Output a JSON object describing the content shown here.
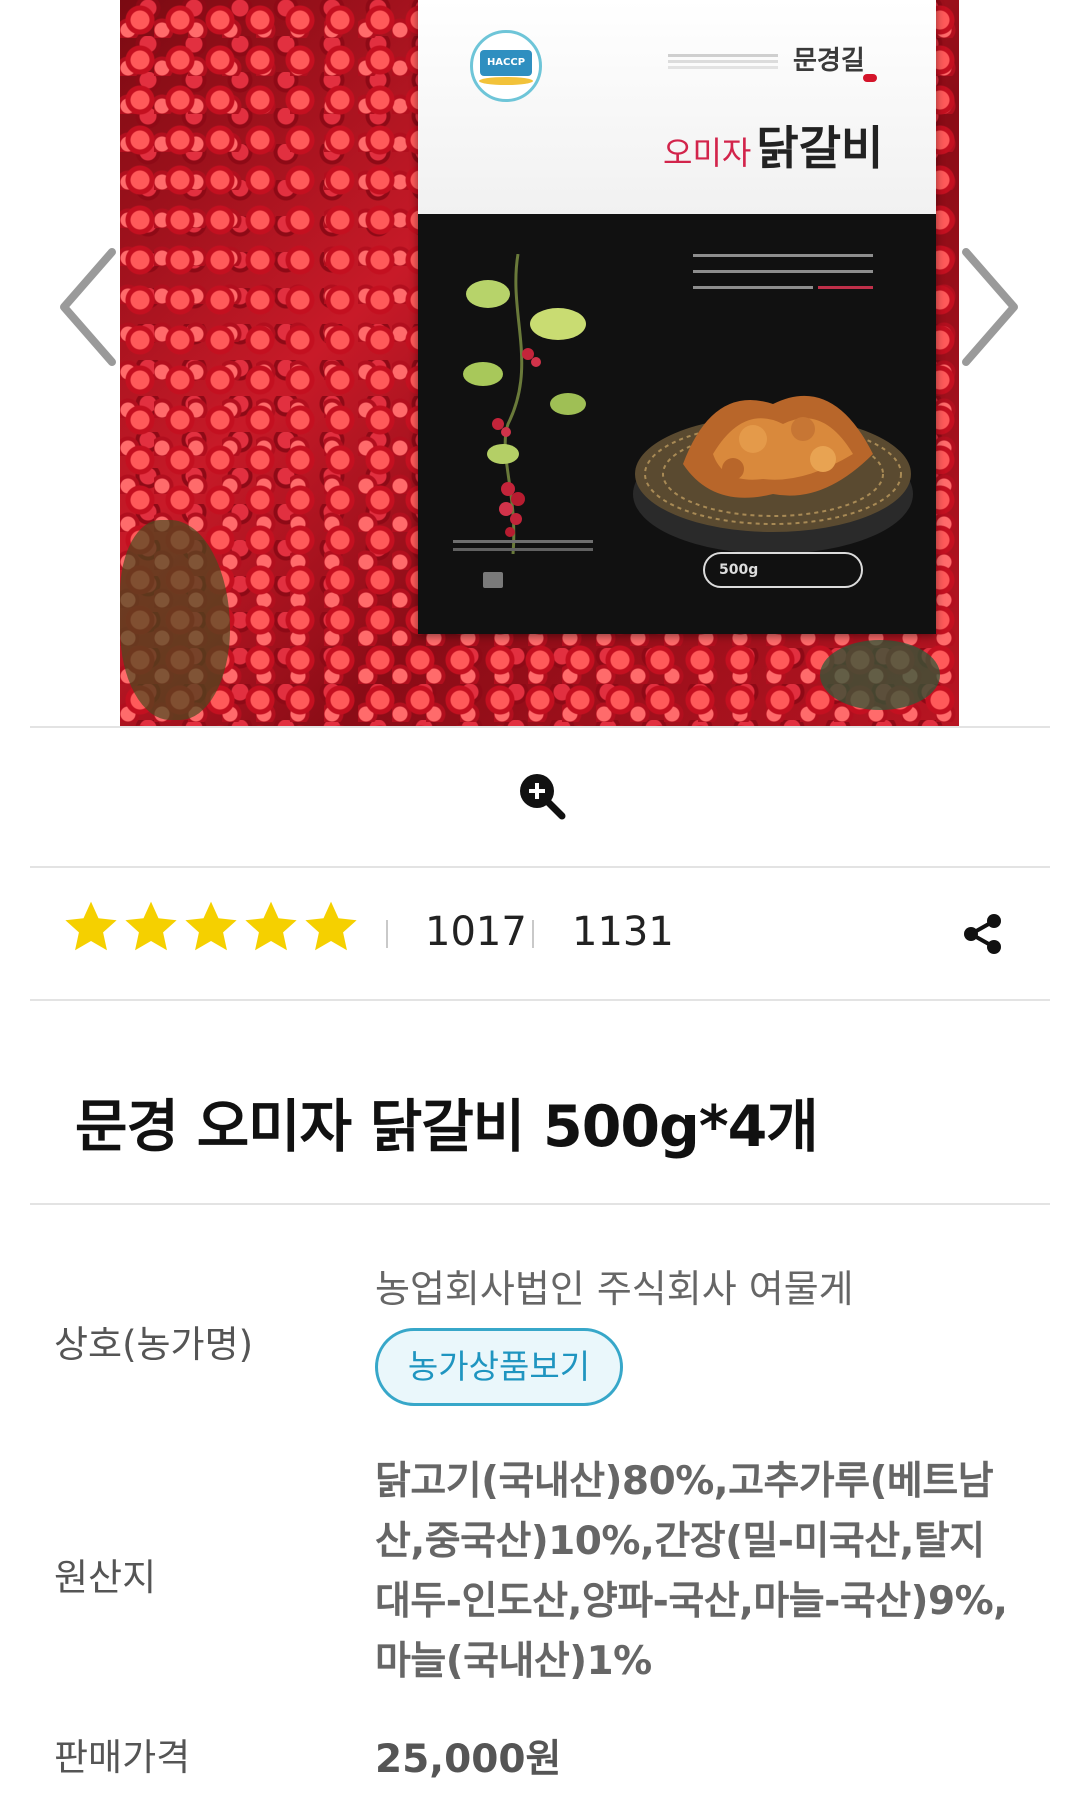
{
  "product_image": {
    "package_brand": "문경길",
    "package_title_small": "오미자",
    "package_title_large": "닭갈비",
    "certification": "HACCP",
    "package_weight": "500g",
    "prev_icon": "chevron-left-icon",
    "next_icon": "chevron-right-icon"
  },
  "zoom": {
    "icon": "zoom-in-icon"
  },
  "rating": {
    "stars": 5,
    "star_color": "#f5d000",
    "count_a": "1017",
    "count_b": "1131",
    "share_icon": "share-icon"
  },
  "product": {
    "title": "문경 오미자 닭갈비 500g*4개"
  },
  "details": {
    "vendor_label": "상호(농가명)",
    "vendor_value": "농업회사법인 주식회사 여물게",
    "farm_button": "농가상품보기",
    "origin_label": "원산지",
    "origin_value": "닭고기(국내산)80%,고추가루(베트남산,중국산)10%,간장(밀-미국산,탈지대두-인도산,양파-국산,마늘-국산)9%,마늘(국내산)1%",
    "price_label": "판매가격",
    "price_value": "25,000원"
  },
  "colors": {
    "accent_border": "#37a7c9",
    "accent_text": "#1f95c0",
    "accent_bg": "#eaf7fb"
  }
}
